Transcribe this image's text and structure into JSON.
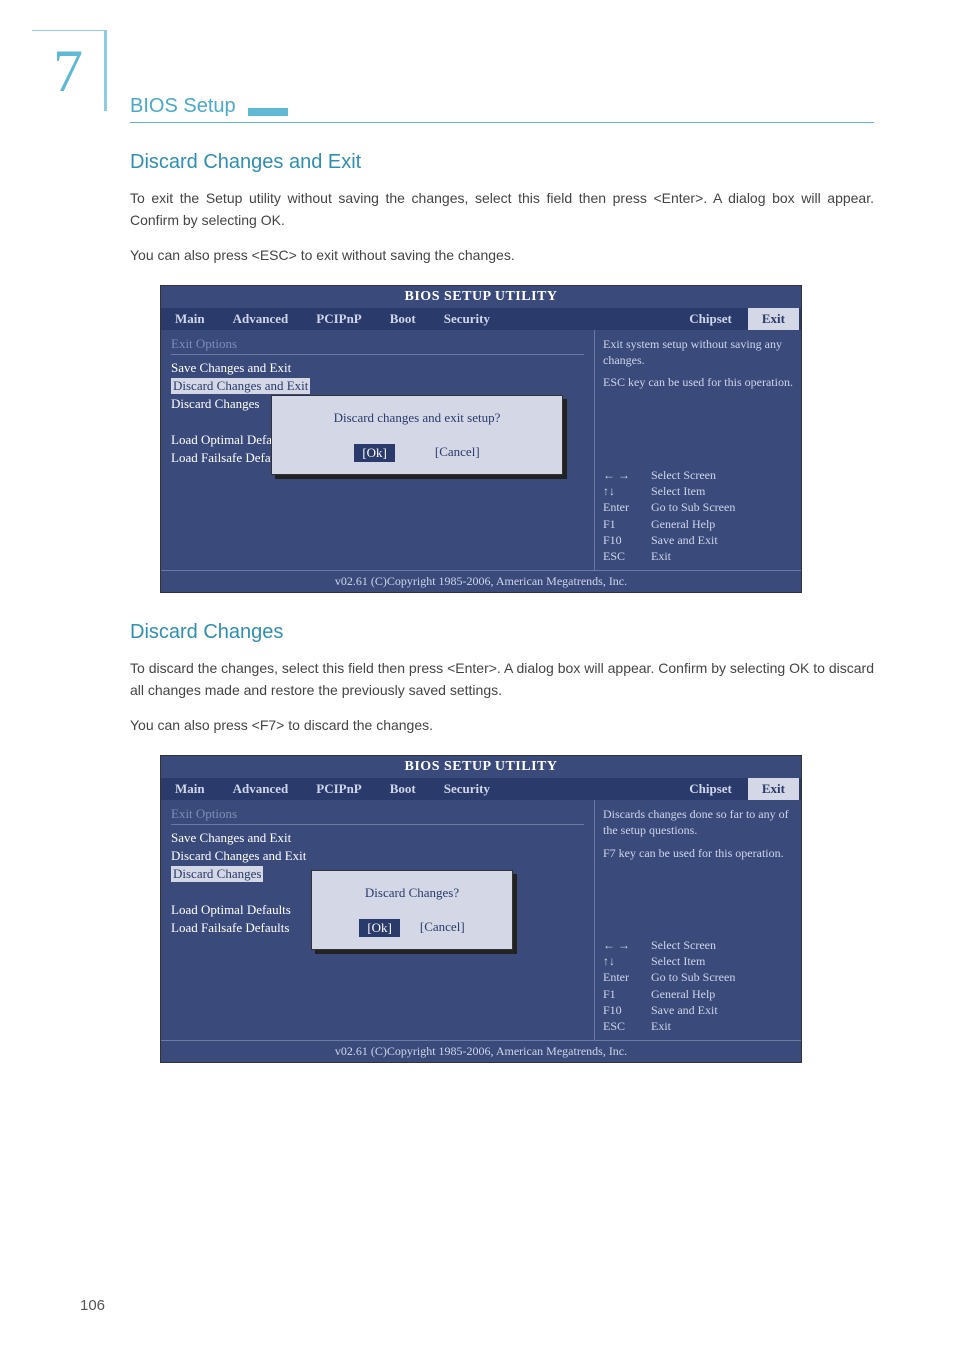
{
  "chapter_num": "7",
  "section_title": "BIOS Setup",
  "h2_1": "Discard Changes and Exit",
  "p1": "To exit the Setup utility without saving the changes, select this field then press <Enter>. A dialog box will appear. Confirm by selecting OK.",
  "p2": "You can also press <ESC> to exit without saving the changes.",
  "h2_2": "Discard Changes",
  "p3": "To discard the changes, select this field then press <Enter>. A dialog box will appear. Confirm by selecting OK to discard all changes made and restore the previously saved settings.",
  "p4": "You can also press <F7> to discard the changes.",
  "bios": {
    "title": "BIOS SETUP UTILITY",
    "tabs": [
      "Main",
      "Advanced",
      "PCIPnP",
      "Boot",
      "Security",
      "Chipset",
      "Exit"
    ],
    "left_header": "Exit Options",
    "items": [
      "Save Changes and Exit",
      "Discard Changes and Exit",
      "Discard Changes",
      "",
      "Load Optimal Defaul",
      "Load Failsafe Defaul"
    ],
    "items_full": [
      "Save Changes and Exit",
      "Discard Changes and Exit",
      "Discard Changes",
      "",
      "Load Optimal Defaults",
      "Load Failsafe Defaults"
    ],
    "help1": "Exit system setup without saving any changes.",
    "help1b": "ESC key can be used for this operation.",
    "help2": "Discards changes done so far to any of the setup questions.",
    "help2b": "F7 key can be used for this operation.",
    "keys": [
      {
        "k": "← →",
        "d": "Select Screen"
      },
      {
        "k": "↑↓",
        "d": "Select Item"
      },
      {
        "k": "Enter",
        "d": "Go to Sub Screen"
      },
      {
        "k": "F1",
        "d": "General Help"
      },
      {
        "k": "F10",
        "d": "Save and Exit"
      },
      {
        "k": "ESC",
        "d": "Exit"
      }
    ],
    "dialog1_q": "Discard changes and exit setup?",
    "dialog2_q": "Discard Changes?",
    "ok": "[Ok]",
    "cancel": "[Cancel]",
    "foot": "v02.61 (C)Copyright 1985-2006, American Megatrends, Inc."
  },
  "page_num": "106"
}
